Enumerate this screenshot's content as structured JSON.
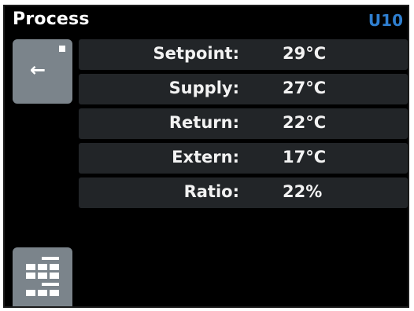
{
  "header": {
    "title": "Process",
    "unit_id": "U10",
    "unit_id_color": "#2f7fd0"
  },
  "nav": {
    "back_icon": "left-arrow-icon",
    "back_glyph": "←",
    "menu_icon": "menu-grid-icon"
  },
  "process": {
    "rows": [
      {
        "label": "Setpoint:",
        "value": "29°C"
      },
      {
        "label": "Supply:",
        "value": "27°C"
      },
      {
        "label": "Return:",
        "value": "22°C"
      },
      {
        "label": "Extern:",
        "value": "17°C"
      },
      {
        "label": "Ratio:",
        "value": "22%"
      }
    ]
  }
}
